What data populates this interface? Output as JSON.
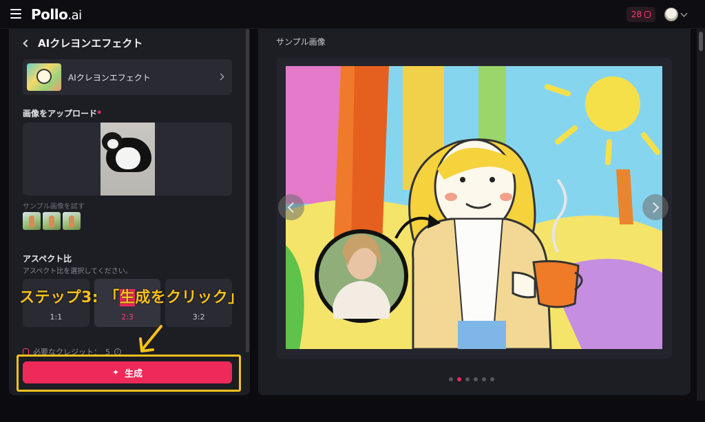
{
  "header": {
    "logo_main": "Pollo",
    "logo_suffix": ".ai",
    "credits": "28"
  },
  "left": {
    "title": "AIクレヨンエフェクト",
    "effect_name": "AIクレヨンエフェクト",
    "upload_label": "画像をアップロード",
    "required_mark": "*",
    "sample_label": "サンプル画像を試す",
    "aspect_title": "アスペクト比",
    "aspect_sub": "アスペクト比を選択してください。",
    "ratios": [
      "1:1",
      "2:3",
      "3:2"
    ],
    "selected_ratio": "2:3",
    "credits_label": "必要なクレジット：",
    "credits_value": "5",
    "generate_label": "生成"
  },
  "annotation": {
    "step_prefix": "ステップ3: 「",
    "step_mark": "生",
    "step_suffix": "成をクリック」"
  },
  "right": {
    "title": "サンプル画像",
    "dots_count": 6,
    "active_dot": 1
  },
  "colors": {
    "accent": "#ee2a5a",
    "annotation": "#f7c21b",
    "panel_bg": "#1d1d24"
  }
}
